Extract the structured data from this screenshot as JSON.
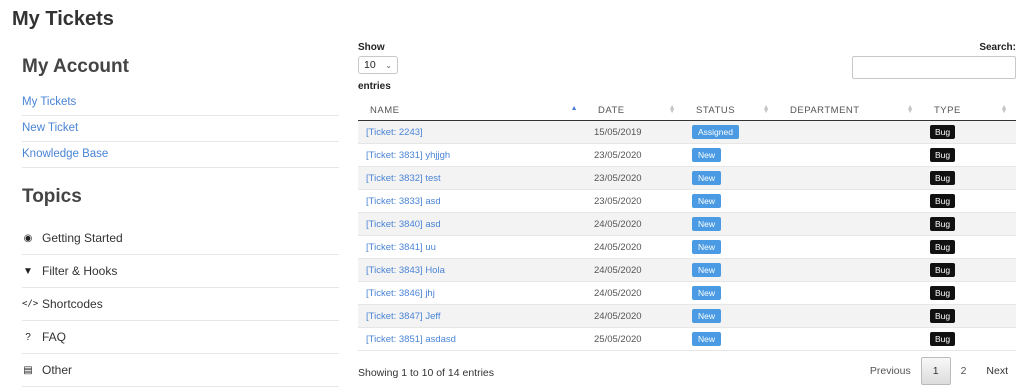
{
  "page": {
    "title": "My Tickets"
  },
  "sidebar": {
    "account_heading": "My Account",
    "account_links": [
      "My Tickets",
      "New Ticket",
      "Knowledge Base"
    ],
    "topics_heading": "Topics",
    "topics": [
      {
        "label": "Getting Started",
        "icon": "play-circle-icon"
      },
      {
        "label": "Filter & Hooks",
        "icon": "filter-icon"
      },
      {
        "label": "Shortcodes",
        "icon": "code-icon"
      },
      {
        "label": "FAQ",
        "icon": "question-circle-icon"
      },
      {
        "label": "Other",
        "icon": "book-icon"
      }
    ]
  },
  "table_controls": {
    "show_label": "Show",
    "length_value": "10",
    "entries_label": "entries",
    "search_label": "Search:",
    "search_value": ""
  },
  "table": {
    "columns": [
      "NAME",
      "DATE",
      "STATUS",
      "DEPARTMENT",
      "TYPE"
    ],
    "rows": [
      {
        "name": "[Ticket: 2243]",
        "date": "15/05/2019",
        "status": "Assigned",
        "department": "",
        "type": "Bug"
      },
      {
        "name": "[Ticket: 3831] yhjjgh",
        "date": "23/05/2020",
        "status": "New",
        "department": "",
        "type": "Bug"
      },
      {
        "name": "[Ticket: 3832] test",
        "date": "23/05/2020",
        "status": "New",
        "department": "",
        "type": "Bug"
      },
      {
        "name": "[Ticket: 3833] asd",
        "date": "23/05/2020",
        "status": "New",
        "department": "",
        "type": "Bug"
      },
      {
        "name": "[Ticket: 3840] asd",
        "date": "24/05/2020",
        "status": "New",
        "department": "",
        "type": "Bug"
      },
      {
        "name": "[Ticket: 3841] uu",
        "date": "24/05/2020",
        "status": "New",
        "department": "",
        "type": "Bug"
      },
      {
        "name": "[Ticket: 3843] Hola",
        "date": "24/05/2020",
        "status": "New",
        "department": "",
        "type": "Bug"
      },
      {
        "name": "[Ticket: 3846] jhj",
        "date": "24/05/2020",
        "status": "New",
        "department": "",
        "type": "Bug"
      },
      {
        "name": "[Ticket: 3847] Jeff",
        "date": "24/05/2020",
        "status": "New",
        "department": "",
        "type": "Bug"
      },
      {
        "name": "[Ticket: 3851] asdasd",
        "date": "25/05/2020",
        "status": "New",
        "department": "",
        "type": "Bug"
      }
    ]
  },
  "footer": {
    "info": "Showing 1 to 10 of 14 entries",
    "prev_label": "Previous",
    "pages": [
      "1",
      "2"
    ],
    "current_page": "1",
    "next_label": "Next"
  },
  "colors": {
    "link": "#4a84d6",
    "status_badge": "#4a9be3",
    "type_badge": "#111111",
    "sort_active": "#4a7fd4"
  }
}
